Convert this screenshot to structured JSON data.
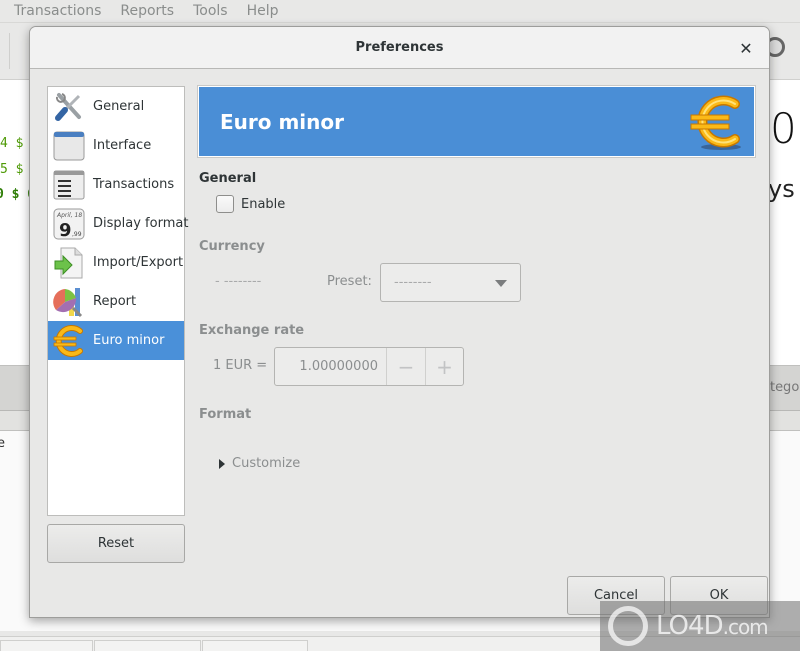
{
  "background_app": {
    "menu": [
      "Transactions",
      "Reports",
      "Tools",
      "Help"
    ],
    "amounts": [
      "4 $",
      "5 $",
      "0 $  6"
    ],
    "big_number": "0",
    "days_text": "ys",
    "category_text": "atego",
    "list_text": "e"
  },
  "dialog": {
    "title": "Preferences",
    "close_icon": "close-icon",
    "sidebar": {
      "items": [
        {
          "label": "General",
          "icon": "tools-icon",
          "active": false
        },
        {
          "label": "Interface",
          "icon": "window-icon",
          "active": false
        },
        {
          "label": "Transactions",
          "icon": "list-icon",
          "active": false
        },
        {
          "label": "Display format",
          "icon": "calendar-icon",
          "active": false
        },
        {
          "label": "Import/Export",
          "icon": "import-export-icon",
          "active": false
        },
        {
          "label": "Report",
          "icon": "report-icon",
          "active": false
        },
        {
          "label": "Euro minor",
          "icon": "euro-icon",
          "active": true
        }
      ],
      "reset_label": "Reset"
    },
    "panel": {
      "banner_title": "Euro minor",
      "banner_icon": "euro-icon",
      "general": {
        "heading": "General",
        "enable_label": "Enable",
        "enable_checked": false
      },
      "currency": {
        "heading": "Currency",
        "value_text": "- --------",
        "preset_label": "Preset:",
        "preset_selected": "--------"
      },
      "exchange_rate": {
        "heading": "Exchange rate",
        "prefix": "1 EUR =",
        "value": "1.00000000",
        "minus_label": "−",
        "plus_label": "+"
      },
      "format": {
        "heading": "Format",
        "customize_label": "Customize",
        "expanded": false
      }
    },
    "buttons": {
      "cancel": "Cancel",
      "ok": "OK"
    }
  },
  "colors": {
    "accent": "#4a90d9",
    "banner": "#4a8ed6",
    "euro_gold": "#f5a800"
  },
  "watermark": {
    "brand": "LO4D",
    "suffix": ".com"
  }
}
